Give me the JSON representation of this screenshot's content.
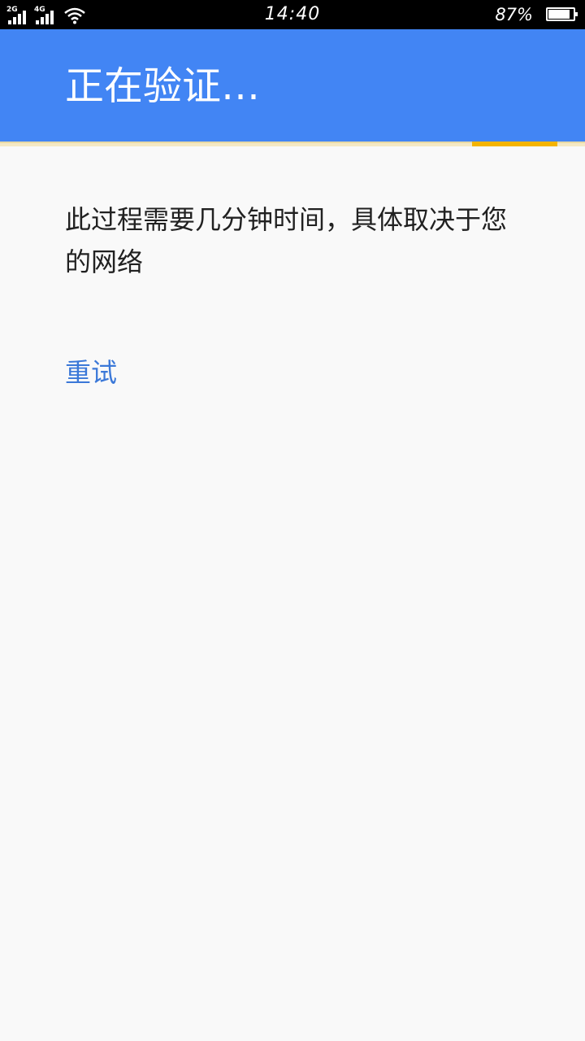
{
  "status_bar": {
    "network_1": "2G",
    "network_2": "4G",
    "time": "14:40",
    "battery_percent_label": "87%",
    "battery_level": 0.87,
    "icons": [
      "signal-2g-icon",
      "signal-4g-icon",
      "wifi-icon",
      "battery-icon"
    ]
  },
  "app_bar": {
    "title": "正在验证…",
    "color": "#4285f4"
  },
  "progress": {
    "type": "indeterminate",
    "color": "#f4b400"
  },
  "content": {
    "message": "此过程需要几分钟时间，具体取决于您的网络",
    "retry_label": "重试",
    "retry_color": "#3b78d8"
  }
}
